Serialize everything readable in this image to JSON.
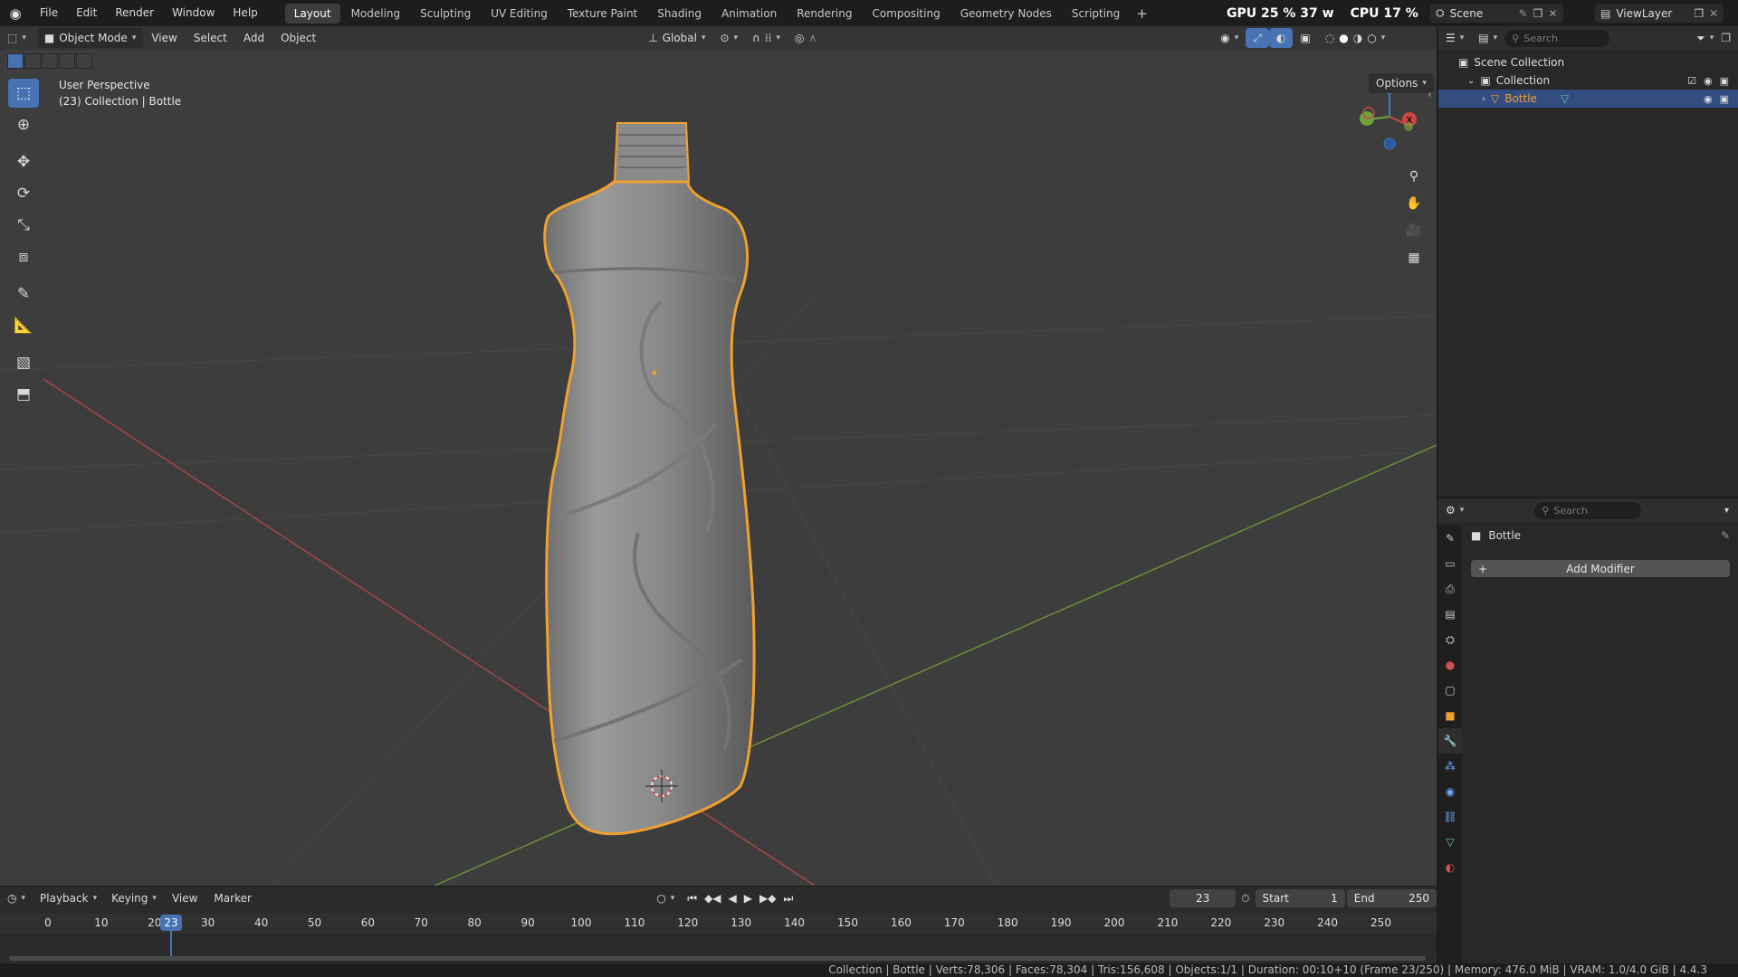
{
  "topbar": {
    "menus": [
      "File",
      "Edit",
      "Render",
      "Window",
      "Help"
    ],
    "workspaces": [
      "Layout",
      "Modeling",
      "Sculpting",
      "UV Editing",
      "Texture Paint",
      "Shading",
      "Animation",
      "Rendering",
      "Compositing",
      "Geometry Nodes",
      "Scripting"
    ],
    "active_workspace": "Layout",
    "add_label": "+",
    "gpu_label": "GPU",
    "gpu_value": "25 %",
    "gpu_power": "37 w",
    "cpu_label": "CPU",
    "cpu_value": "17 %",
    "scene": "Scene",
    "view_layer": "ViewLayer"
  },
  "viewport": {
    "mode": "Object Mode",
    "menus": [
      "View",
      "Select",
      "Add",
      "Object"
    ],
    "orientation": "Global",
    "perspective_label": "User Perspective",
    "collection_label": "(23) Collection | Bottle",
    "options_label": "Options",
    "gizmo_labels": {
      "z": "Z",
      "x": "X"
    }
  },
  "timeline": {
    "menus": [
      "Playback",
      "Keying",
      "View",
      "Marker"
    ],
    "current_frame": "23",
    "start_label": "Start",
    "start_value": "1",
    "end_label": "End",
    "end_value": "250",
    "ticks": [
      "0",
      "10",
      "20",
      "30",
      "40",
      "50",
      "60",
      "70",
      "80",
      "90",
      "100",
      "110",
      "120",
      "130",
      "140",
      "150",
      "160",
      "170",
      "180",
      "190",
      "200",
      "210",
      "220",
      "230",
      "240",
      "250"
    ]
  },
  "status": {
    "text": "Collection | Bottle | Verts:78,306 | Faces:78,304 | Tris:156,608 | Objects:1/1 | Duration: 00:10+10 (Frame 23/250) | Memory: 476.0 MiB | VRAM: 1.0/4.0 GiB | 4.4.3"
  },
  "outliner": {
    "search_placeholder": "Search",
    "scene_collection": "Scene Collection",
    "collection": "Collection",
    "object": "Bottle"
  },
  "properties": {
    "search_placeholder": "Search",
    "object_name": "Bottle",
    "add_modifier_label": "Add Modifier"
  },
  "colors": {
    "selection_outline": "#f0a030",
    "accent_blue": "#4772b3",
    "x_axis": "#c94a4a",
    "y_axis": "#7aa23c"
  }
}
